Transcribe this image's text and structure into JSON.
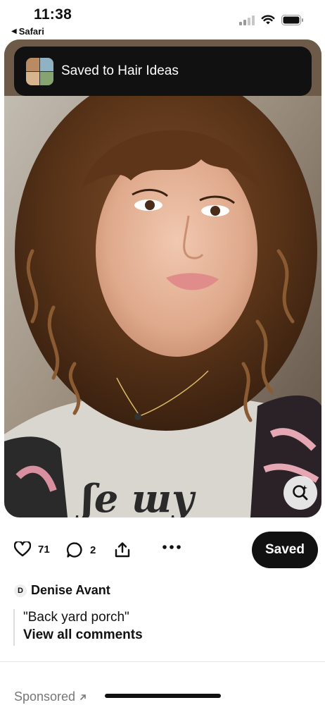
{
  "status_bar": {
    "time": "11:38",
    "back_app": "Safari",
    "back_icon": "back-triangle-icon"
  },
  "toast": {
    "message": "Saved to Hair Ideas",
    "thumb_colors": [
      "#b98b63",
      "#8fb3c2",
      "#d6b48c",
      "#86a372"
    ]
  },
  "pin": {
    "lens_icon": "visual-search-icon"
  },
  "actions": {
    "likes": "71",
    "comments": "2",
    "save_label": "Saved"
  },
  "author": {
    "initial": "D",
    "name": "Denise Avant"
  },
  "comments": {
    "preview": "\"Back yard porch\"",
    "view_all": "View all comments"
  },
  "footer": {
    "sponsored": "Sponsored"
  },
  "colors": {
    "primary_button": "#111111",
    "background": "#ffffff"
  }
}
